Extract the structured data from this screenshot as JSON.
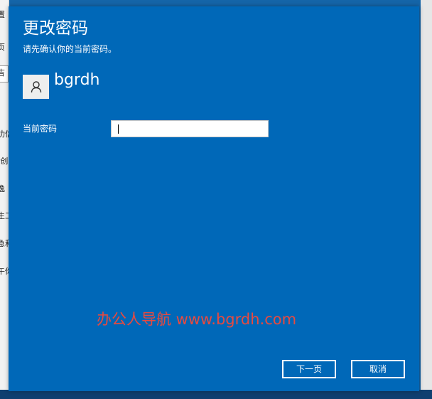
{
  "background": {
    "fragments": [
      "置",
      "页",
      "吉",
      "扐信",
      "t创",
      "逸",
      "生工",
      "急和",
      "午你"
    ]
  },
  "dialog": {
    "title": "更改密码",
    "subtitle": "请先确认你的当前密码。",
    "account": {
      "avatar_icon": "user-icon",
      "username": "bgrdh"
    },
    "current_password": {
      "label": "当前密码",
      "value": "",
      "placeholder": ""
    },
    "watermark": "办公人导航  www.bgrdh.com",
    "buttons": {
      "next": "下一页",
      "cancel": "取消"
    },
    "colors": {
      "background": "#0068b8",
      "watermark": "#e84a3f"
    }
  }
}
